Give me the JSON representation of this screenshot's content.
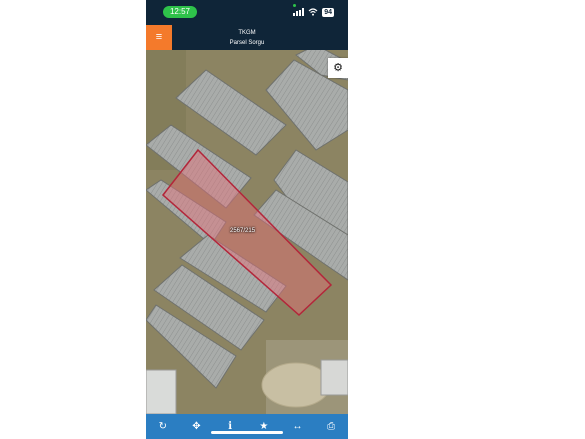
{
  "status_bar": {
    "time": "12:57",
    "battery": "94",
    "icons": [
      "signal-icon",
      "wifi-icon",
      "battery-icon"
    ]
  },
  "header": {
    "menu_icon": "hamburger-menu-icon",
    "title": "TKGM",
    "subtitle": "Parsel Sorgu",
    "colors": {
      "header_bg": "#0f2538",
      "menu_bg": "#f47a2b"
    }
  },
  "map": {
    "settings_icon": "gear-icon",
    "parcel_label": "2567/215",
    "parcel_color": "#b3263a"
  },
  "toolbar": {
    "background": "#2b7ec2",
    "items": [
      {
        "icon": "refresh-icon",
        "glyph": "↻"
      },
      {
        "icon": "locate-icon",
        "glyph": "✥"
      },
      {
        "icon": "info-icon",
        "glyph": "i"
      },
      {
        "icon": "star-icon",
        "glyph": "★"
      },
      {
        "icon": "measure-icon",
        "glyph": "↔"
      },
      {
        "icon": "print-icon",
        "glyph": "⎙"
      }
    ]
  }
}
